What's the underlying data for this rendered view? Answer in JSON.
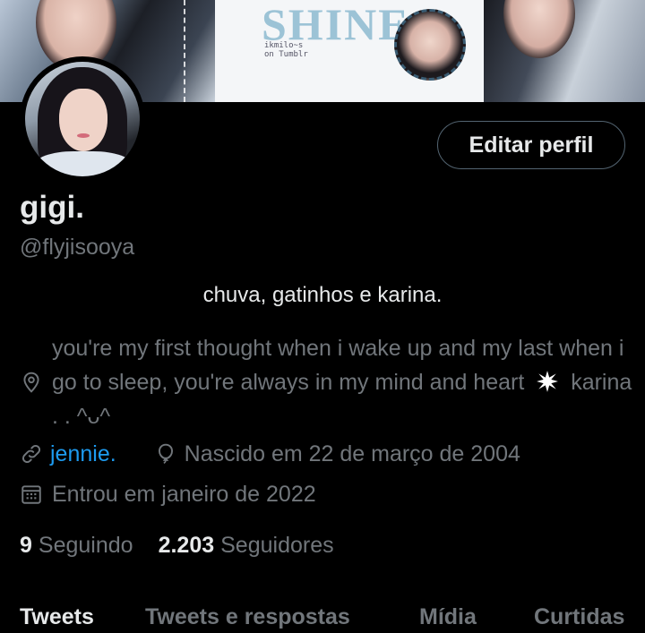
{
  "banner": {
    "title_word": "SHINE",
    "sub_text": "ikmilo~s\non Tumblr"
  },
  "profile": {
    "edit_button": "Editar perfil",
    "name": "gigi.",
    "handle": "@flyjisooya",
    "bio_line": "chuva, gatinhos e karina.",
    "location_text_a": "you're my first thought when i wake up and my last when i go to sleep, you're always in my mind and heart",
    "location_text_b": "karina . . ^ᴗ^",
    "website": "jennie.",
    "birthday": "Nascido em 22 de março de 2004",
    "joined": "Entrou em janeiro de 2022"
  },
  "stats": {
    "following_count": "9",
    "following_label": "Seguindo",
    "followers_count": "2.203",
    "followers_label": "Seguidores"
  },
  "tabs": [
    {
      "label": "Tweets"
    },
    {
      "label": "Tweets e respostas"
    },
    {
      "label": "Mídia"
    },
    {
      "label": "Curtidas"
    }
  ],
  "colors": {
    "background": "#000000",
    "text_primary": "#e7e9ea",
    "text_secondary": "#71767b",
    "link": "#1d9bf0"
  }
}
